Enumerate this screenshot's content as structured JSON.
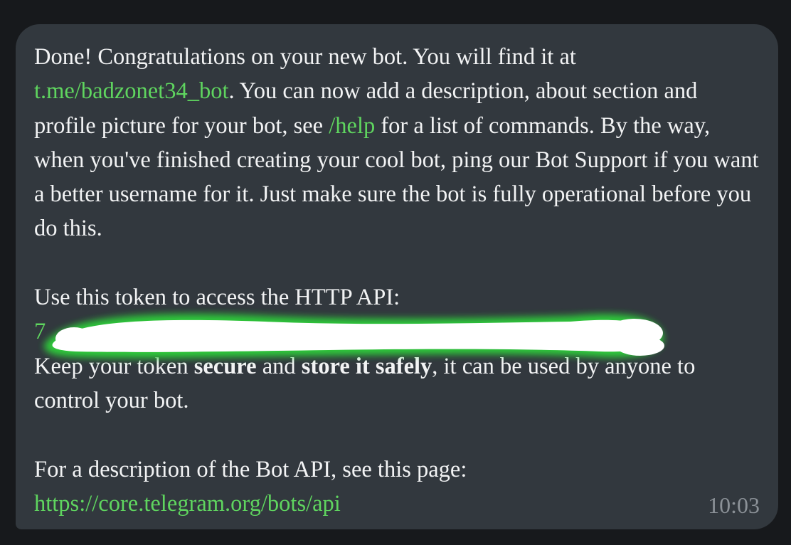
{
  "message": {
    "p1_a": "Done! Congratulations on your new bot. You will find it at",
    "bot_link": "t.me/badzonet34_bot",
    "p1_b": ". You can now add a description, about section and profile picture for your bot, see ",
    "help_link": "/help",
    "p1_c": " for a list of commands. By the way, when you've finished creating your cool bot, ping our Bot Support if you want a better username for it. Just make sure the bot is fully operational before you do this.",
    "token_intro": "Use this token to access the HTTP API:",
    "token_visible": "7",
    "keep_a": "Keep your token ",
    "keep_secure": "secure",
    "keep_b": " and ",
    "keep_safely": "store it safely",
    "keep_c": ", it can be used by anyone to control your bot.",
    "api_intro": "For a description of the Bot API, see this page:",
    "api_link": "https://core.telegram.org/bots/api"
  },
  "time": "10:03",
  "colors": {
    "background": "#17191c",
    "bubble": "#32383e",
    "text": "#f2f3f4",
    "link": "#5fd55f",
    "time": "#8b9197",
    "redaction": "#ffffff",
    "redaction_glow": "#2fd13a"
  }
}
